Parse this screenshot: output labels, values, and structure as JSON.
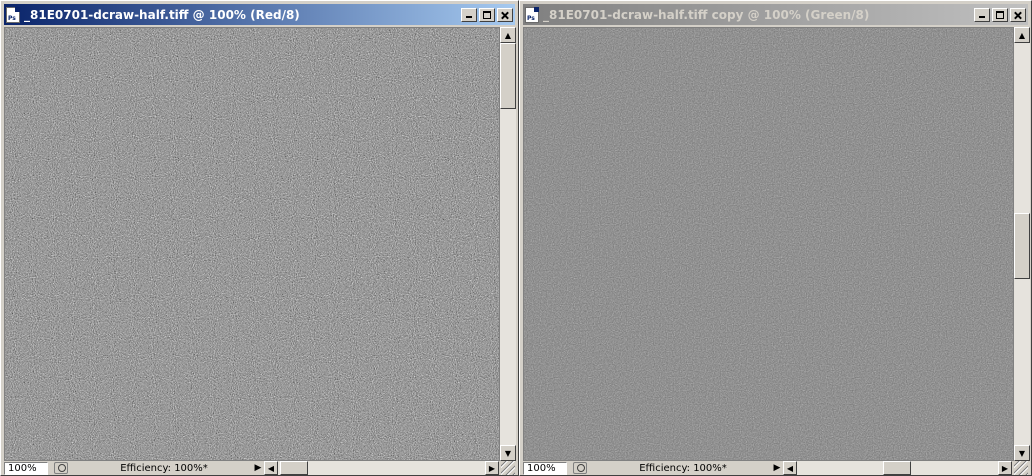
{
  "left_window": {
    "title": "_81E0701-dcraw-half.tiff @ 100% (Red/8)",
    "zoom": "100%",
    "efficiency_label": "Efficiency: 100%*",
    "state": "active",
    "noise_level": "high"
  },
  "right_window": {
    "title": "_81E0701-dcraw-half.tiff copy @ 100% (Green/8)",
    "zoom": "100%",
    "efficiency_label": "Efficiency: 100%*",
    "state": "inactive",
    "noise_level": "low"
  },
  "icons": {
    "app": "photoshop-document-icon",
    "minimize": "minimize-icon",
    "maximize": "maximize-icon",
    "close": "close-icon",
    "navigator": "navigator-icon"
  },
  "colors": {
    "active_title_start": "#0a246a",
    "active_title_end": "#a6caf0",
    "inactive_title_start": "#808080",
    "inactive_title_end": "#c0c0c0",
    "chrome": "#d4d0c8"
  }
}
